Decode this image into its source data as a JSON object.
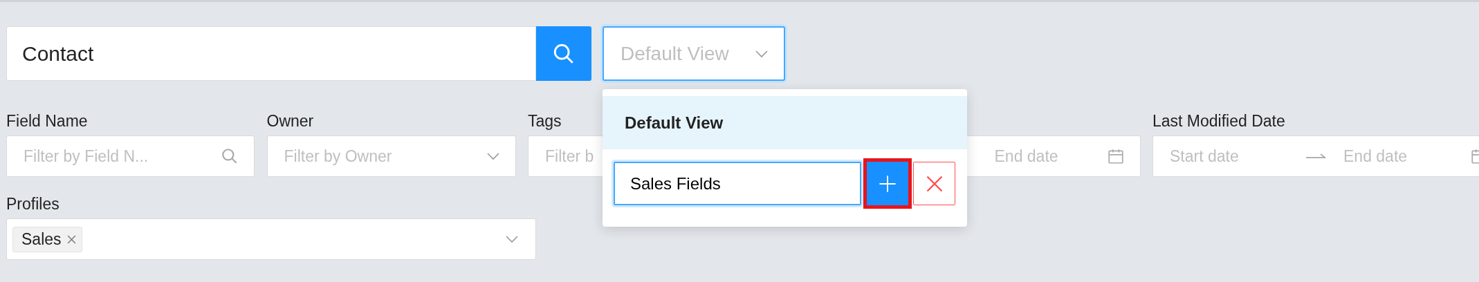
{
  "search": {
    "value": "Contact"
  },
  "view_select": {
    "placeholder": "Default View"
  },
  "filters": [
    {
      "label": "Field Name",
      "kind": "search",
      "placeholder": "Filter by Field N..."
    },
    {
      "label": "Owner",
      "kind": "select",
      "placeholder": "Filter by Owner"
    },
    {
      "label": "Tags",
      "kind": "text",
      "placeholder": "Filter b"
    },
    {
      "kind": "date_range",
      "end_placeholder": "End date"
    },
    {
      "label": "Last Modified Date",
      "kind": "date_range",
      "start_placeholder": "Start date",
      "end_placeholder": "End date"
    }
  ],
  "profiles": {
    "label": "Profiles",
    "tags": [
      "Sales"
    ]
  },
  "view_menu": {
    "items": [
      {
        "label": "Default View",
        "selected": true
      }
    ],
    "new_view": {
      "value": "Sales Fields"
    },
    "add_highlighted": true
  }
}
